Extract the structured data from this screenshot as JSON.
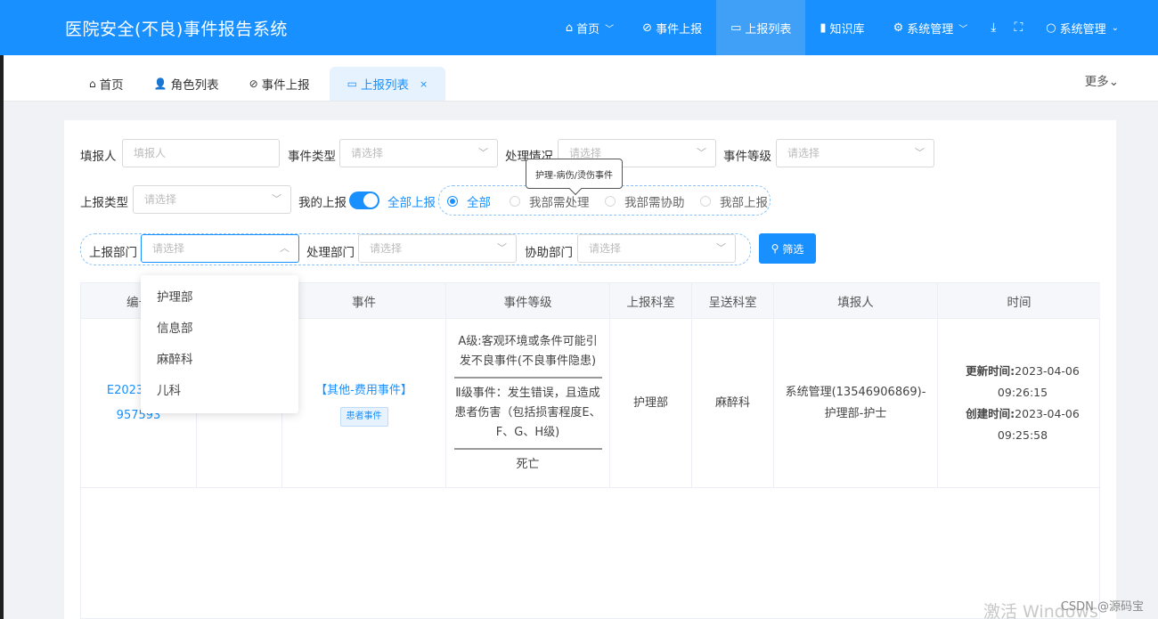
{
  "app": {
    "title": "医院安全(不良)事件报告系统"
  },
  "topnav": {
    "home": "首页",
    "report_event": "事件上报",
    "report_list": "上报列表",
    "knowledge": "知识库",
    "system_mgmt": "系统管理",
    "user_menu": "系统管理"
  },
  "tabs": [
    {
      "label": "首页"
    },
    {
      "label": "角色列表"
    },
    {
      "label": "事件上报"
    },
    {
      "label": "上报列表"
    }
  ],
  "more_label": "更多",
  "filters": {
    "reporter_label": "填报人",
    "reporter_placeholder": "填报人",
    "event_type_label": "事件类型",
    "event_type_placeholder": "请选择",
    "handle_status_label": "处理情况",
    "handle_status_placeholder": "请选择",
    "event_level_label": "事件等级",
    "event_level_placeholder": "请选择",
    "report_type_label": "上报类型",
    "report_type_placeholder": "请选择",
    "my_report_label": "我的上报",
    "all_report_label": "全部上报",
    "radios": [
      "全部",
      "我部需处理",
      "我部需协助",
      "我部上报"
    ],
    "report_dept_label": "上报部门",
    "report_dept_placeholder": "请选择",
    "handle_dept_label": "处理部门",
    "handle_dept_placeholder": "请选择",
    "assist_dept_label": "协助部门",
    "assist_dept_placeholder": "请选择",
    "filter_button": "筛选"
  },
  "tooltip": "护理-病伤/烫伤事件",
  "dropdown_options": [
    "护理部",
    "信息部",
    "麻醉科",
    "儿科"
  ],
  "table": {
    "headers": [
      "编号",
      "事件",
      "事件等级",
      "上报科室",
      "呈送科室",
      "填报人",
      "时间"
    ],
    "rows": [
      {
        "id_line1": "E2023040(",
        "id_line2": "957593",
        "event": "【其他-费用事件】",
        "event_tag": "患者事件",
        "level_a": "A级:客观环境或条件可能引发不良事件(不良事件隐患)",
        "level_b": "Ⅱ级事件：发生错误，且造成患者伤害（包括损害程度E、F、G、H级)",
        "level_c": "死亡",
        "report_dept": "护理部",
        "send_dept": "麻醉科",
        "reporter": "系统管理(13546906869)-护理部-护士",
        "updated_label": "更新时间:",
        "updated": "2023-04-06 09:26:15",
        "created_label": "创建时间:",
        "created": "2023-04-06 09:25:58"
      }
    ]
  },
  "watermark": "激活 Windows",
  "csdn": "CSDN @源码宝"
}
